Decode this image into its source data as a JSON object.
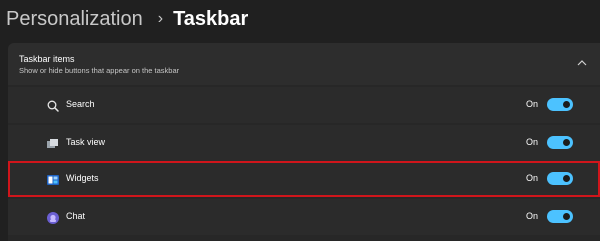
{
  "breadcrumb": {
    "parent": "Personalization",
    "separator": "›",
    "current": "Taskbar"
  },
  "section": {
    "title": "Taskbar items",
    "subtitle": "Show or hide buttons that appear on the taskbar",
    "collapse_icon": "chevron-up-icon",
    "items": [
      {
        "label": "Search",
        "state": "On",
        "enabled": true,
        "icon": "search-icon"
      },
      {
        "label": "Task view",
        "state": "On",
        "enabled": true,
        "icon": "task-view-icon"
      },
      {
        "label": "Widgets",
        "state": "On",
        "enabled": true,
        "icon": "widgets-icon",
        "highlighted": true
      },
      {
        "label": "Chat",
        "state": "On",
        "enabled": true,
        "icon": "chat-icon"
      }
    ]
  },
  "colors": {
    "background": "#202020",
    "accent": "#4cc2ff",
    "highlight_border": "#d0151b"
  }
}
